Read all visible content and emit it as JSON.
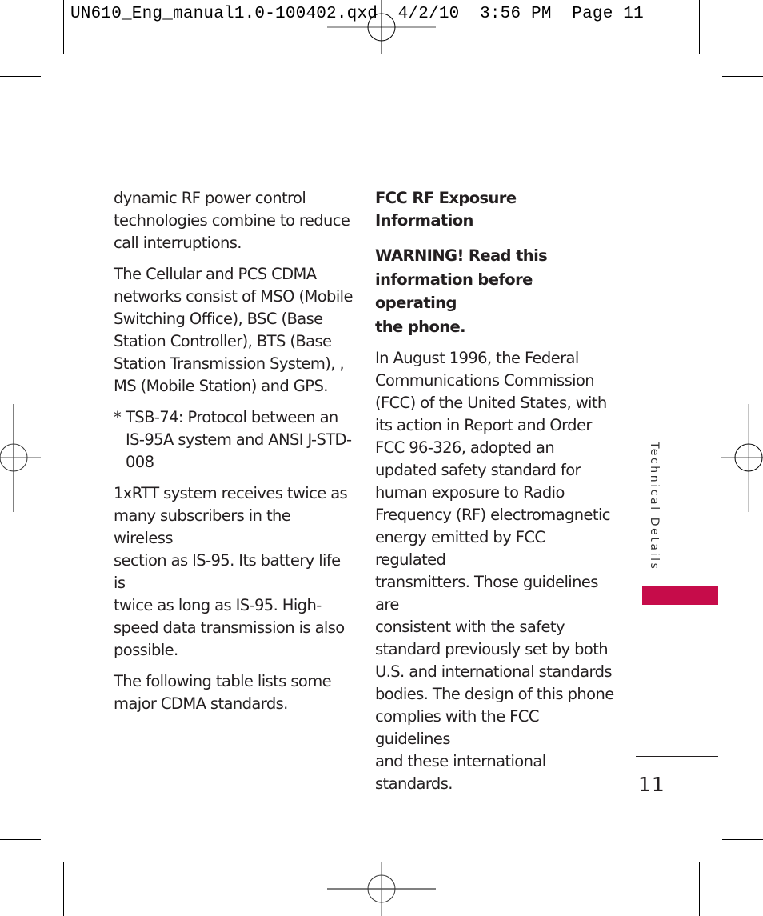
{
  "slug_line": "UN610_Eng_manual1.0-100402.qxd  4/2/10  3:56 PM  Page 11",
  "left_column": {
    "paragraphs": [
      [
        "dynamic RF power control",
        "technologies combine to reduce",
        "call interruptions."
      ],
      [
        "The Cellular and PCS CDMA",
        "networks consist of MSO (Mobile",
        "Switching Office), BSC (Base",
        "Station Controller), BTS (Base",
        "Station Transmission System), ,",
        "MS (Mobile Station) and GPS."
      ]
    ],
    "footnote": {
      "marker": "*",
      "lines": [
        "TSB-74: Protocol between an",
        "IS-95A system and ANSI J-STD-",
        "008"
      ]
    },
    "paragraphs_after": [
      [
        "1xRTT system receives twice as",
        "many subscribers in the wireless",
        "section as IS-95. Its battery life is",
        "twice as long as IS-95. High-",
        "speed data transmission is also",
        "possible."
      ],
      [
        "The following table lists some",
        "major CDMA standards."
      ]
    ]
  },
  "right_column": {
    "heading": "FCC RF Exposure Information",
    "warning": [
      "WARNING! Read this",
      "information before operating",
      "the phone."
    ],
    "body": [
      "In August 1996, the Federal",
      "Communications Commission",
      "(FCC) of the United States, with",
      "its action in Report and Order",
      "FCC 96-326, adopted an",
      "updated safety standard for",
      "human exposure to Radio",
      "Frequency (RF) electromagnetic",
      "energy emitted by FCC regulated",
      "transmitters. Those guidelines are",
      "consistent with the safety",
      "standard previously set by both",
      "U.S. and international standards",
      "bodies. The design of this phone",
      "complies with the FCC guidelines",
      "and these international",
      "standards."
    ]
  },
  "side_tab": {
    "label": "Technical Details",
    "color": "#c60c4a"
  },
  "page_number": "11"
}
